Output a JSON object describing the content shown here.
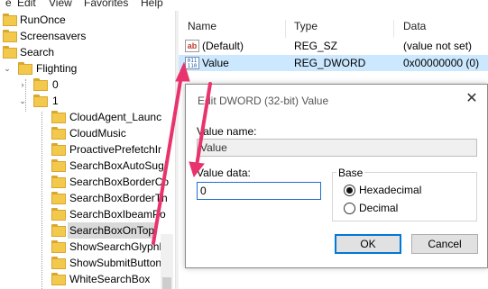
{
  "menubar": {
    "items": [
      {
        "label": "e"
      },
      {
        "label": "Edit"
      },
      {
        "label": "View"
      },
      {
        "label": "Favorites"
      },
      {
        "label": "Help"
      }
    ]
  },
  "tree": {
    "items": [
      {
        "label": "RunOnce"
      },
      {
        "label": "Screensavers"
      },
      {
        "label": "Search"
      },
      {
        "label": "Flighting"
      },
      {
        "label": "0"
      },
      {
        "label": "1"
      },
      {
        "label": "CloudAgent_Launc"
      },
      {
        "label": "CloudMusic"
      },
      {
        "label": "ProactivePrefetchIr"
      },
      {
        "label": "SearchBoxAutoSug"
      },
      {
        "label": "SearchBoxBorderCo"
      },
      {
        "label": "SearchBoxBorderTh"
      },
      {
        "label": "SearchBoxIbeamPo"
      },
      {
        "label": "SearchBoxOnTop"
      },
      {
        "label": "ShowSearchGlyphL"
      },
      {
        "label": "ShowSubmitButton"
      },
      {
        "label": "WhiteSearchBox"
      }
    ],
    "expanded_arrow": "⌄",
    "collapsed_arrow": "›"
  },
  "list": {
    "columns": {
      "name": "Name",
      "type": "Type",
      "data": "Data"
    },
    "rows": [
      {
        "name": "(Default)",
        "type": "REG_SZ",
        "data": "(value not set)",
        "icon": "string-value-icon",
        "icon_text": "ab"
      },
      {
        "name": "Value",
        "type": "REG_DWORD",
        "data": "0x00000000 (0)",
        "icon": "binary-value-icon",
        "icon_text": "011 110"
      }
    ]
  },
  "dialog": {
    "title": "Edit DWORD (32-bit) Value",
    "close_glyph": "✕",
    "value_name_label": "Value name:",
    "value_name": "Value",
    "value_data_label": "Value data:",
    "value_data": "0",
    "base_label": "Base",
    "hex_label": "Hexadecimal",
    "dec_label": "Decimal",
    "ok_label": "OK",
    "cancel_label": "Cancel"
  },
  "colors": {
    "annotation": "#e8336d",
    "selection": "#cce8ff",
    "accent": "#0078d7"
  }
}
